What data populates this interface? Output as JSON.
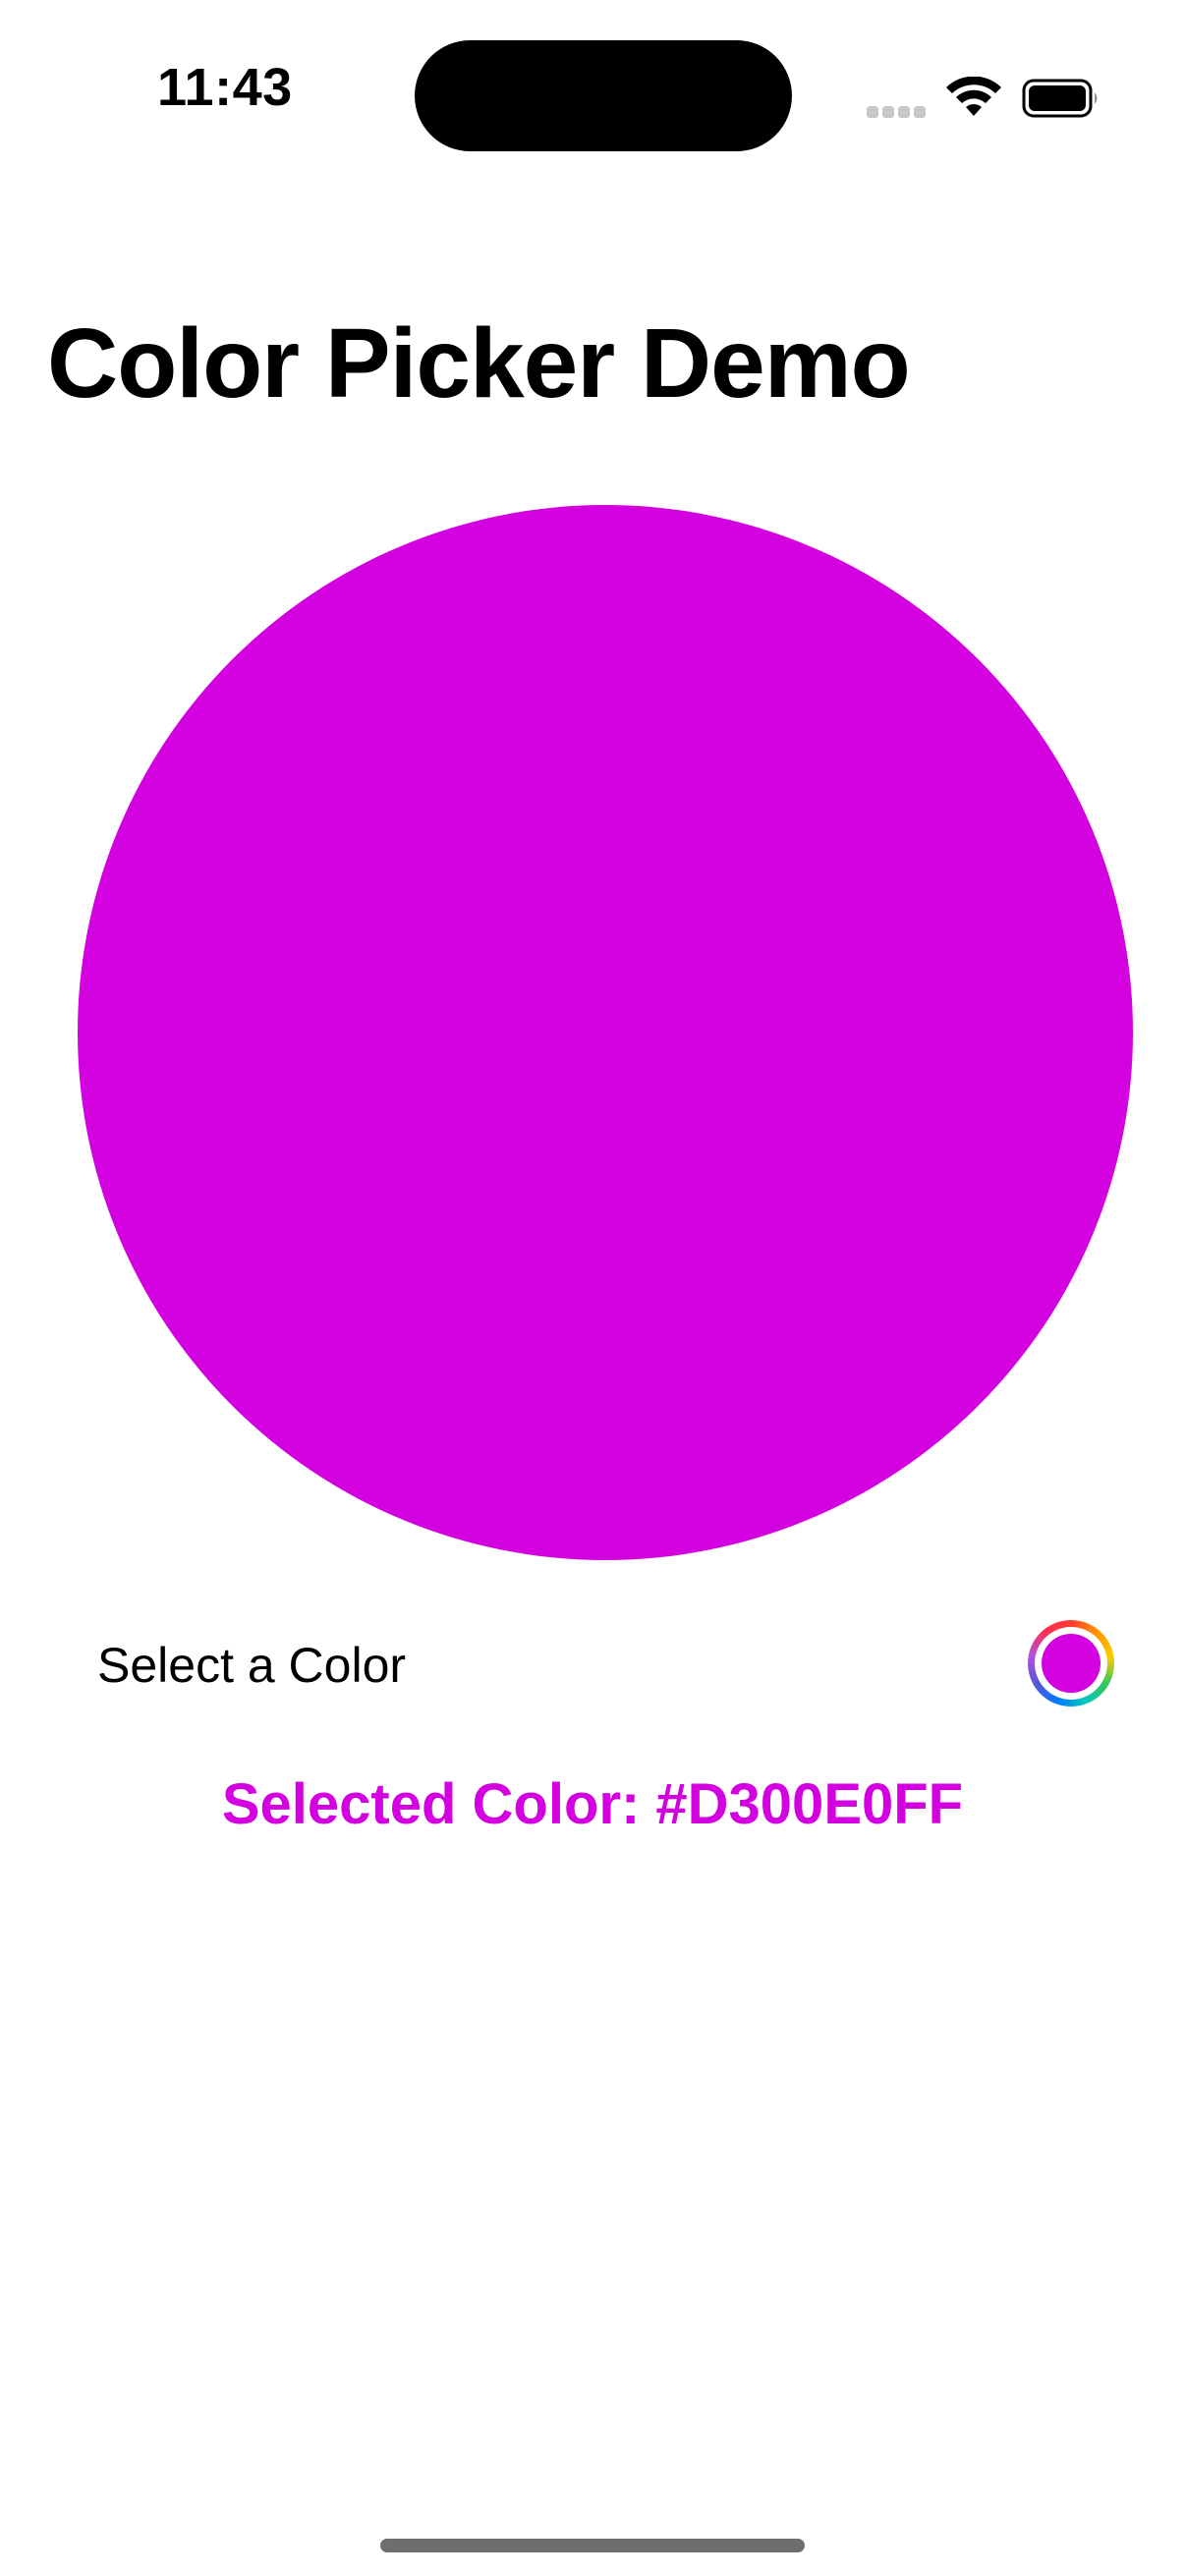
{
  "status_bar": {
    "time": "11:43",
    "wifi_icon": "wifi-icon",
    "battery_icon": "battery-icon",
    "signal_icon": "cellular-signal-icon"
  },
  "page": {
    "title": "Color Picker Demo"
  },
  "preview": {
    "color": "#D300E0"
  },
  "picker": {
    "label": "Select a Color",
    "selected_color": "#D300E0",
    "well_icon": "color-wheel-icon"
  },
  "selected_text": "Selected Color: #D300E0FF",
  "colors": {
    "accent": "#D300E0",
    "background": "#FFFFFF",
    "text": "#000000"
  }
}
